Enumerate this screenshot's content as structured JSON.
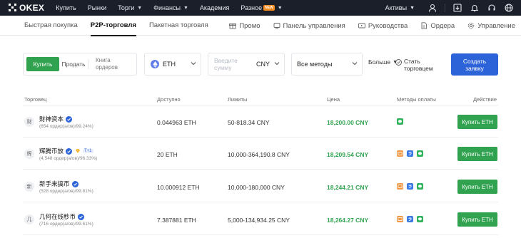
{
  "topnav": {
    "logo_text": "OKEX",
    "items": [
      {
        "label": "Купить",
        "chevron": false,
        "badge": ""
      },
      {
        "label": "Рынки",
        "chevron": false,
        "badge": ""
      },
      {
        "label": "Торги",
        "chevron": true,
        "badge": ""
      },
      {
        "label": "Финансы",
        "chevron": true,
        "badge": ""
      },
      {
        "label": "Академия",
        "chevron": false,
        "badge": ""
      },
      {
        "label": "Разное",
        "chevron": true,
        "badge": "NEW"
      }
    ],
    "assets_label": "Активы",
    "icons": [
      "user-icon",
      "download-icon",
      "bell-icon",
      "headset-icon",
      "globe-icon"
    ]
  },
  "subnav": {
    "tabs": [
      {
        "label": "Быстрая покупка",
        "active": false
      },
      {
        "label": "P2P-торговля",
        "active": true
      },
      {
        "label": "Пакетная торговля",
        "active": false
      }
    ],
    "links": [
      {
        "label": "Промо",
        "icon": "gift-icon"
      },
      {
        "label": "Панель управления",
        "icon": "dashboard-icon"
      },
      {
        "label": "Руководства",
        "icon": "video-icon"
      },
      {
        "label": "Ордера",
        "icon": "document-icon"
      },
      {
        "label": "Управление",
        "icon": "settings-icon"
      }
    ]
  },
  "filters": {
    "buy_label": "Купить",
    "sell_label": "Продать",
    "book_label_1": "Книга",
    "book_label_2": "ордеров",
    "coin": "ETH",
    "amount_placeholder": "Введите сумму",
    "currency": "CNY",
    "method": "Все методы",
    "more_label": "Больше",
    "become_label_1": "Стать",
    "become_label_2": "торговцем",
    "create_label_1": "Создать",
    "create_label_2": "заявку"
  },
  "table": {
    "headers": {
      "merchant": "Торговец",
      "available": "Доступно",
      "limits": "Лимиты",
      "price": "Цена",
      "methods": "Методы оплаты",
      "action": "Действие"
    },
    "rows": [
      {
        "avatar": "财",
        "name": "財神资本",
        "tier": "",
        "stats": "(654 ордер(а/ов)/99.24%)",
        "available": "0.044963 ETH",
        "limits": "50-818.34 CNY",
        "price": "18,200.00 CNY",
        "methods": [
          "wechat"
        ],
        "button": "Купить ETH"
      },
      {
        "avatar": "辉",
        "name": "辉腾币放",
        "tier": "T+1",
        "stats": "(4,548 ордер(а/ов)/96.33%)",
        "available": "20 ETH",
        "limits": "10,000-364,190.8 CNY",
        "price": "18,209.54 CNY",
        "methods": [
          "bank",
          "alipay",
          "wechat"
        ],
        "button": "Купить ETH"
      },
      {
        "avatar": "新",
        "name": "新手来搞币",
        "tier": "",
        "stats": "(528 ордер(а/ов)/99.81%)",
        "available": "10.000912 ETH",
        "limits": "10,000-180,000 CNY",
        "price": "18,244.21 CNY",
        "methods": [
          "bank",
          "alipay",
          "wechat"
        ],
        "button": "Купить ETH"
      },
      {
        "avatar": "几",
        "name": "几何在线秒币",
        "tier": "",
        "stats": "(716 ордер(а/ов)/99.61%)",
        "available": "7.387881 ETH",
        "limits": "5,000-134,934.25 CNY",
        "price": "18,264.27 CNY",
        "methods": [
          "bank",
          "alipay",
          "wechat"
        ],
        "button": "Купить ETH"
      }
    ]
  },
  "colors": {
    "nav_bg": "#1b1f2a",
    "buy_green": "#31a350",
    "primary_blue": "#2d63d8",
    "badge_orange": "#f2891b"
  }
}
